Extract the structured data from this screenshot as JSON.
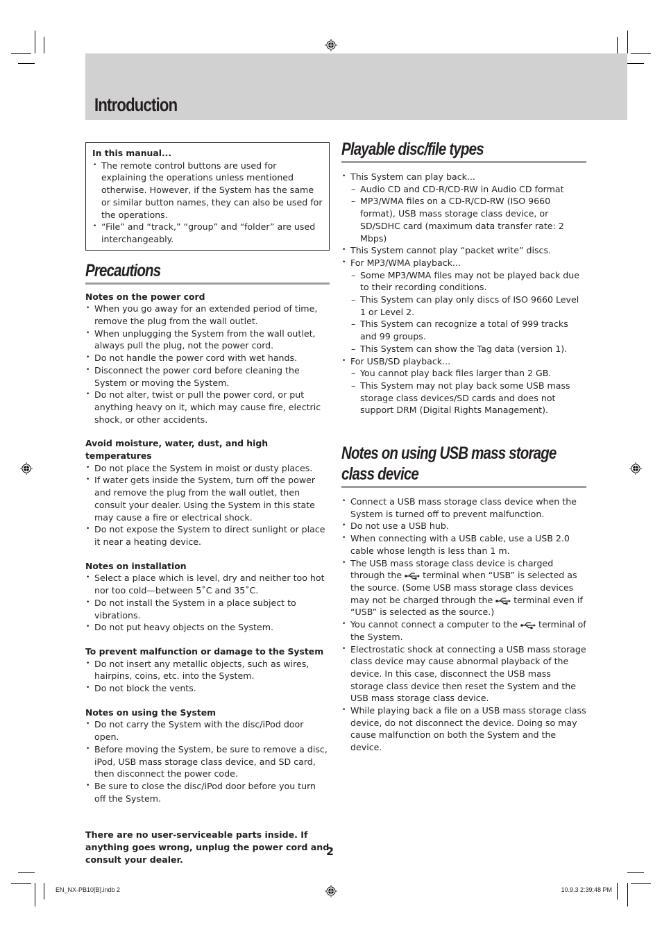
{
  "header": {
    "title": "Introduction"
  },
  "manual_box": {
    "title": "In this manual...",
    "items": [
      "The remote control buttons are used for explaining the operations unless mentioned otherwise. However, if the System has the same or similar button names, they can also be used for the operations.",
      "“File” and “track,” “group” and “folder” are used interchangeably."
    ]
  },
  "precautions": {
    "title": "Precautions",
    "groups": [
      {
        "title": "Notes on the power cord",
        "items": [
          "When you go away for an extended period of time, remove the plug from the wall outlet.",
          "When unplugging the System from the wall outlet, always pull the plug, not the power cord.",
          "Do not handle the power cord with wet hands.",
          "Disconnect the power cord before cleaning the System or moving the System.",
          "Do not alter, twist or pull the power cord, or put anything heavy on it, which may cause fire, electric shock, or other accidents."
        ]
      },
      {
        "title": "Avoid moisture, water, dust, and high temperatures",
        "items": [
          "Do not place the System in moist or dusty places.",
          "If water gets inside the System, turn off the power and remove the plug from the wall outlet, then consult your dealer. Using the System in this state may cause a fire or electrical shock.",
          "Do not expose the System to direct sunlight or place it near a heating device."
        ]
      },
      {
        "title": "Notes on installation",
        "items": [
          "Select a place which is level, dry and neither too hot nor too cold—between 5˚C and 35˚C.",
          "Do not install the System in a place subject to vibrations.",
          "Do not put heavy objects on the System."
        ]
      },
      {
        "title": "To prevent malfunction or damage to the System",
        "items": [
          "Do not insert any metallic objects, such as wires, hairpins, coins, etc. into the System.",
          "Do not block the vents."
        ]
      },
      {
        "title": "Notes on using the System",
        "items": [
          "Do not carry the System with the disc/iPod door open.",
          "Before moving the System, be sure to remove a disc, iPod, USB mass storage class device, and SD card, then disconnect the power code.",
          "Be sure to close the disc/iPod door before you turn off the System."
        ]
      }
    ],
    "warning": "There are no user-serviceable parts inside. If anything goes wrong, unplug the power cord and consult your dealer."
  },
  "playable": {
    "title": "Playable disc/file types",
    "items": [
      {
        "text": "This System can play back...",
        "sub": [
          "Audio CD and CD-R/CD-RW in Audio CD format",
          "MP3/WMA files on a CD-R/CD-RW (ISO 9660 format), USB mass storage class device, or SD/SDHC card (maximum data transfer rate: 2 Mbps)"
        ]
      },
      {
        "text": "This System cannot play “packet write” discs.",
        "sub": []
      },
      {
        "text": "For MP3/WMA playback...",
        "sub": [
          "Some MP3/WMA files may not be played back due to their recording conditions.",
          "This System can play only discs of ISO 9660 Level 1 or Level 2.",
          "This System can recognize a total of 999 tracks and 99 groups.",
          "This System can show the Tag data (version 1)."
        ]
      },
      {
        "text": "For USB/SD playback...",
        "sub": [
          "You cannot play back files larger than 2 GB.",
          "This System may not play back some USB mass storage class devices/SD cards and does not support DRM (Digital Rights Management)."
        ]
      }
    ]
  },
  "usb_notes": {
    "title": "Notes on using USB mass storage class device",
    "items": [
      {
        "parts": [
          "Connect a USB mass storage class device when the System is turned off to prevent malfunction."
        ]
      },
      {
        "parts": [
          "Do not use a USB hub."
        ]
      },
      {
        "parts": [
          "When connecting with a USB cable, use a USB 2.0 cable whose length is less than 1 m."
        ]
      },
      {
        "parts": [
          "The USB mass storage class device is charged through the ",
          " terminal when “USB” is selected as the source. (Some USB mass storage class devices may not be charged through the ",
          " terminal even if “USB” is selected as the source.)"
        ]
      },
      {
        "parts": [
          "You cannot connect a computer to the ",
          " terminal of the System."
        ]
      },
      {
        "parts": [
          "Electrostatic shock at connecting a USB mass storage class device may cause abnormal playback of the device. In this case, disconnect the USB mass storage class device then reset the System and the USB mass storage class device."
        ]
      },
      {
        "parts": [
          "While playing back a file on a USB mass storage class device, do not disconnect the device. Doing so may cause malfunction on both the System and the device."
        ]
      }
    ]
  },
  "footer": {
    "page_number": "2",
    "slug_left": "EN_NX-PB10[B].indb   2",
    "slug_right": "10.9.3   2:39:48 PM"
  }
}
